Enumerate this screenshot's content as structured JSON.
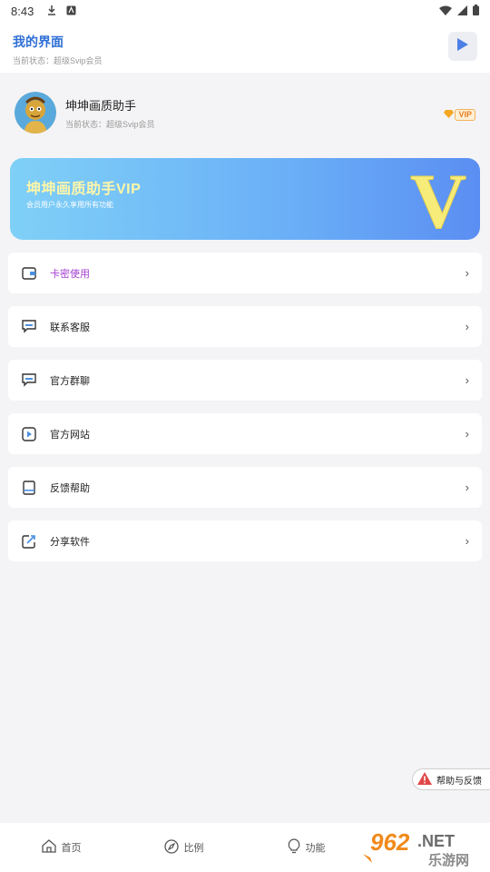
{
  "status_bar": {
    "time": "8:43"
  },
  "header": {
    "title": "我的界面",
    "subtitle": "当前状态：超级Svip会员"
  },
  "profile": {
    "name": "坤坤画质助手",
    "status": "当前状态：超级Svip会员",
    "badge": "VIP"
  },
  "banner": {
    "title": "坤坤画质助手VIP",
    "subtitle": "会员用户永久享用所有功能",
    "letter": "V"
  },
  "menu": [
    {
      "label": "卡密使用",
      "icon": "wallet-icon"
    },
    {
      "label": "联系客服",
      "icon": "chat-icon"
    },
    {
      "label": "官方群聊",
      "icon": "chat-icon"
    },
    {
      "label": "官方网站",
      "icon": "play-icon"
    },
    {
      "label": "反馈帮助",
      "icon": "book-icon"
    },
    {
      "label": "分享软件",
      "icon": "share-icon"
    }
  ],
  "help_float": {
    "label": "帮助与反馈"
  },
  "nav": [
    {
      "label": "首页",
      "icon": "home-icon"
    },
    {
      "label": "比例",
      "icon": "compass-icon"
    },
    {
      "label": "功能",
      "icon": "bulb-icon"
    }
  ],
  "watermark": {
    "number": "962",
    "suffix": ".NET",
    "site": "乐游网"
  },
  "colors": {
    "accent": "#2f6fd6",
    "menu_accent": "#a33fd1",
    "banner_title": "#fff6a8"
  }
}
